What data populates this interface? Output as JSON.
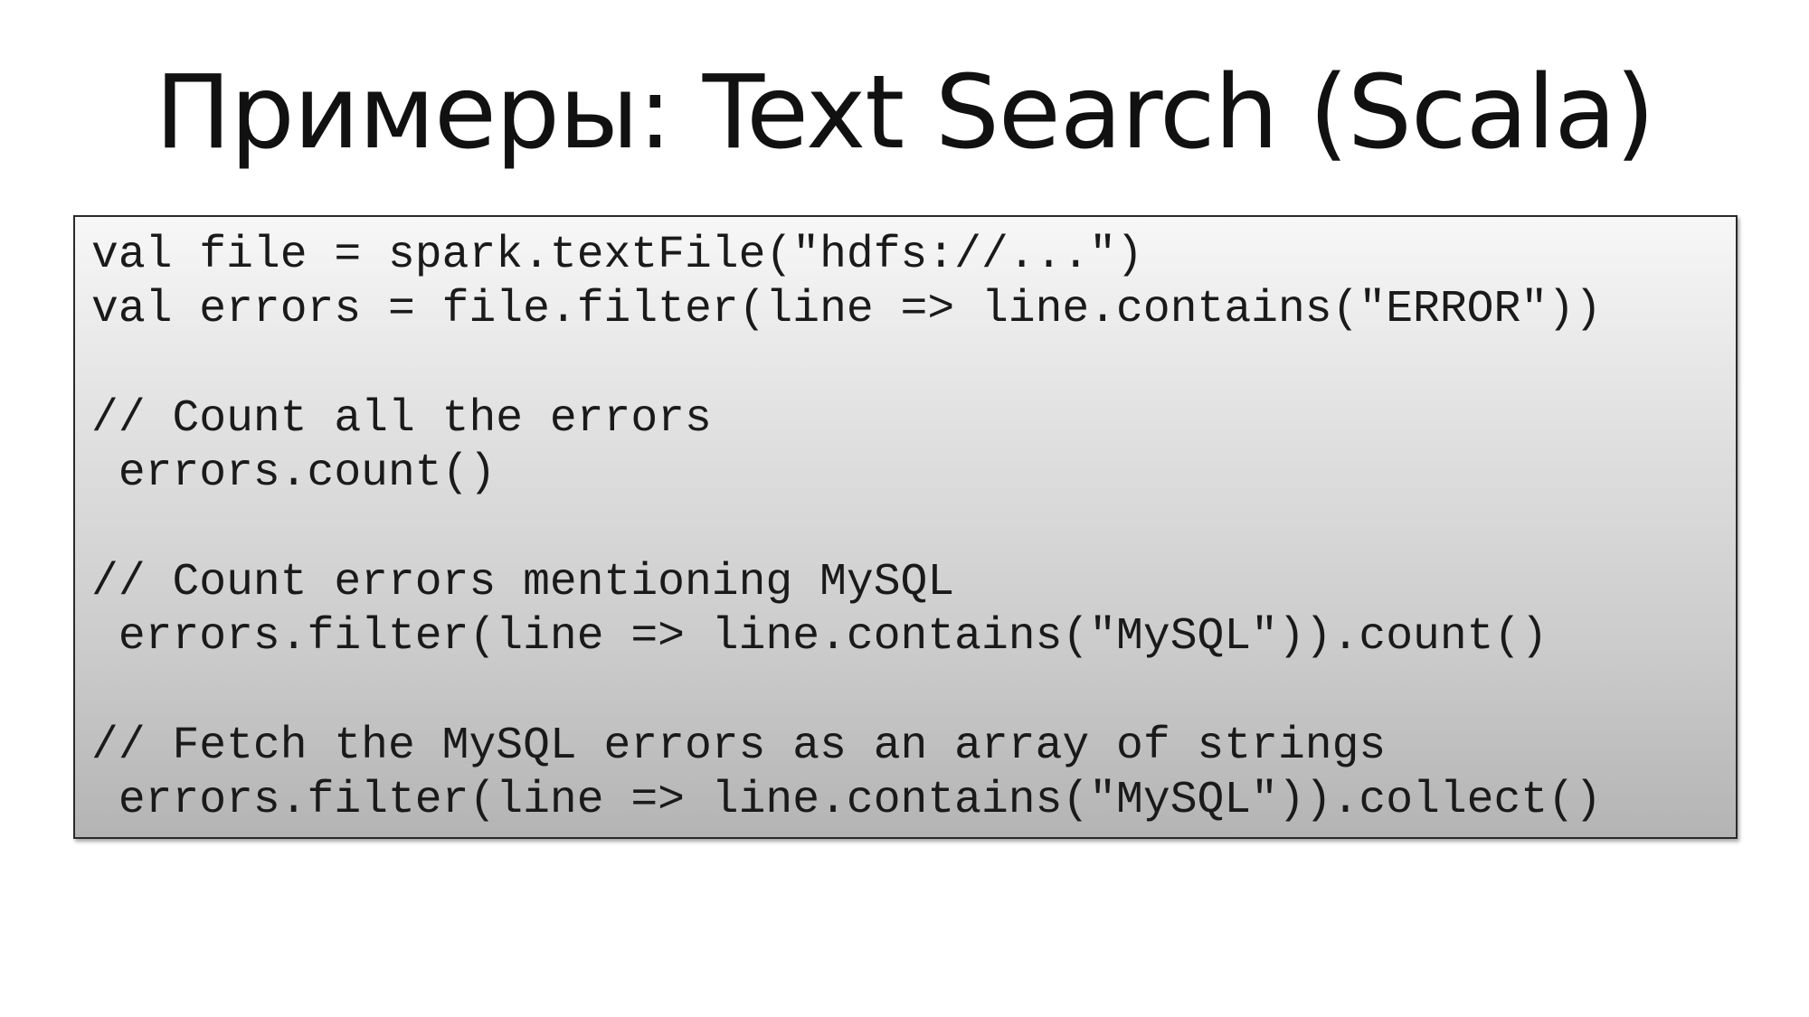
{
  "slide": {
    "title": "Примеры: Text Search (Scala)",
    "code_lines": [
      "val file = spark.textFile(\"hdfs://...\")",
      "val errors = file.filter(line => line.contains(\"ERROR\"))",
      "",
      "// Count all the errors",
      " errors.count()",
      "",
      "// Count errors mentioning MySQL",
      " errors.filter(line => line.contains(\"MySQL\")).count()",
      "",
      "// Fetch the MySQL errors as an array of strings",
      " errors.filter(line => line.contains(\"MySQL\")).collect()"
    ]
  }
}
